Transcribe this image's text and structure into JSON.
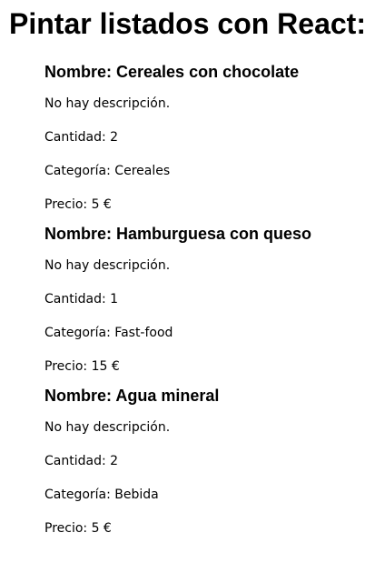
{
  "page": {
    "title": "Pintar listados con React:"
  },
  "products": [
    {
      "name": "Nombre: Cereales con chocolate",
      "description": "No hay descripción.",
      "quantity": "Cantidad: 2",
      "category": "Categoría: Cereales",
      "price": "Precio: 5 €"
    },
    {
      "name": "Nombre: Hamburguesa con queso",
      "description": "No hay descripción.",
      "quantity": "Cantidad: 1",
      "category": "Categoría: Fast-food",
      "price": "Precio: 15 €"
    },
    {
      "name": "Nombre: Agua mineral",
      "description": "No hay descripción.",
      "quantity": "Cantidad: 2",
      "category": "Categoría: Bebida",
      "price": "Precio: 5 €"
    }
  ]
}
